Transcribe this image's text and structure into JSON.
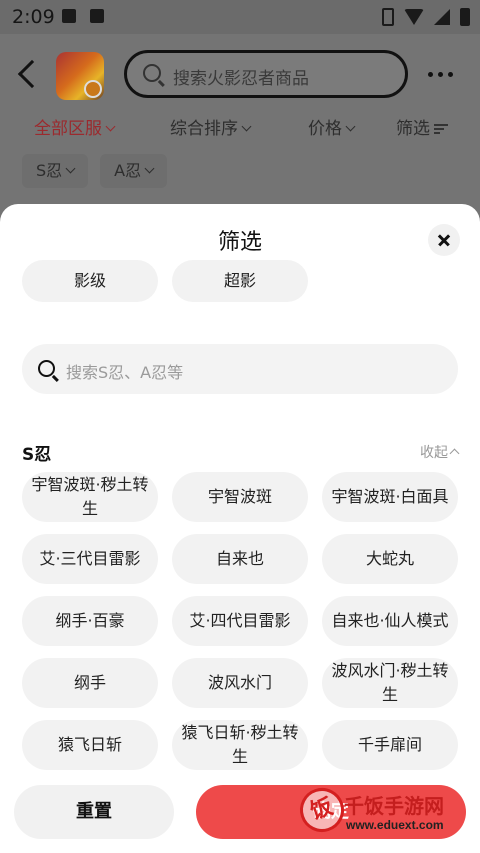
{
  "status_bar": {
    "time": "2:09"
  },
  "header": {
    "search_placeholder": "搜索火影忍者商品"
  },
  "filters": {
    "region": "全部区服",
    "sort": "综合排序",
    "price": "价格",
    "filter": "筛选"
  },
  "grade_chips": [
    "S忍",
    "A忍"
  ],
  "sheet": {
    "title": "筛选",
    "levels": [
      "影级",
      "超影"
    ],
    "search_placeholder": "搜索S忍、A忍等",
    "section": {
      "title": "S忍",
      "collapse_label": "收起"
    },
    "ninjas": [
      "宇智波斑·秽土转生",
      "宇智波斑",
      "宇智波斑·白面具",
      "艾·三代目雷影",
      "自来也",
      "大蛇丸",
      "纲手·百豪",
      "艾·四代目雷影",
      "自来也·仙人模式",
      "纲手",
      "波风水门",
      "波风水门·秽土转生",
      "猿飞日斩",
      "猿飞日斩·秽土转生",
      "千手扉间"
    ],
    "reset_label": "重置",
    "confirm_label": "确定"
  },
  "watermark": {
    "logo_char": "饭",
    "name": "千饭手游网",
    "url": "www.eduext.com"
  },
  "colors": {
    "accent": "#ee4a4a",
    "active_filter": "#9b2a2e"
  }
}
